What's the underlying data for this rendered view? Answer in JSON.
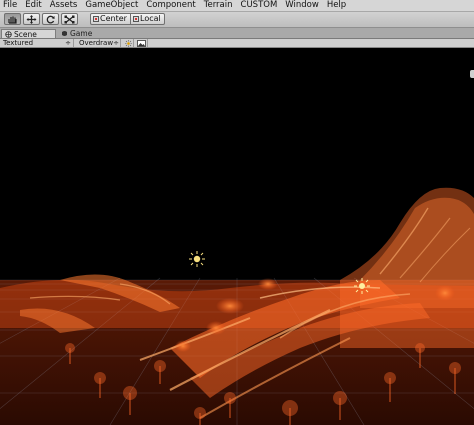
{
  "menu": [
    "File",
    "Edit",
    "Assets",
    "GameObject",
    "Component",
    "Terrain",
    "CUSTOM",
    "Window",
    "Help"
  ],
  "toolbar": {
    "tools": [
      "hand-tool-icon",
      "move-tool-icon",
      "rotate-tool-icon",
      "scale-tool-icon"
    ],
    "center_label": "Center",
    "local_label": "Local"
  },
  "tabs": [
    {
      "label": "Scene",
      "icon": "scene-icon",
      "active": true
    },
    {
      "label": "Game",
      "icon": "game-icon",
      "active": false
    }
  ],
  "scene_toolbar": {
    "render_mode": "Textured",
    "draw_mode": "Overdraw",
    "light_icon": "sun-icon",
    "image_icon": "image-icon"
  },
  "colors": {
    "overdraw": "#ff6a28",
    "background": "#000000"
  }
}
